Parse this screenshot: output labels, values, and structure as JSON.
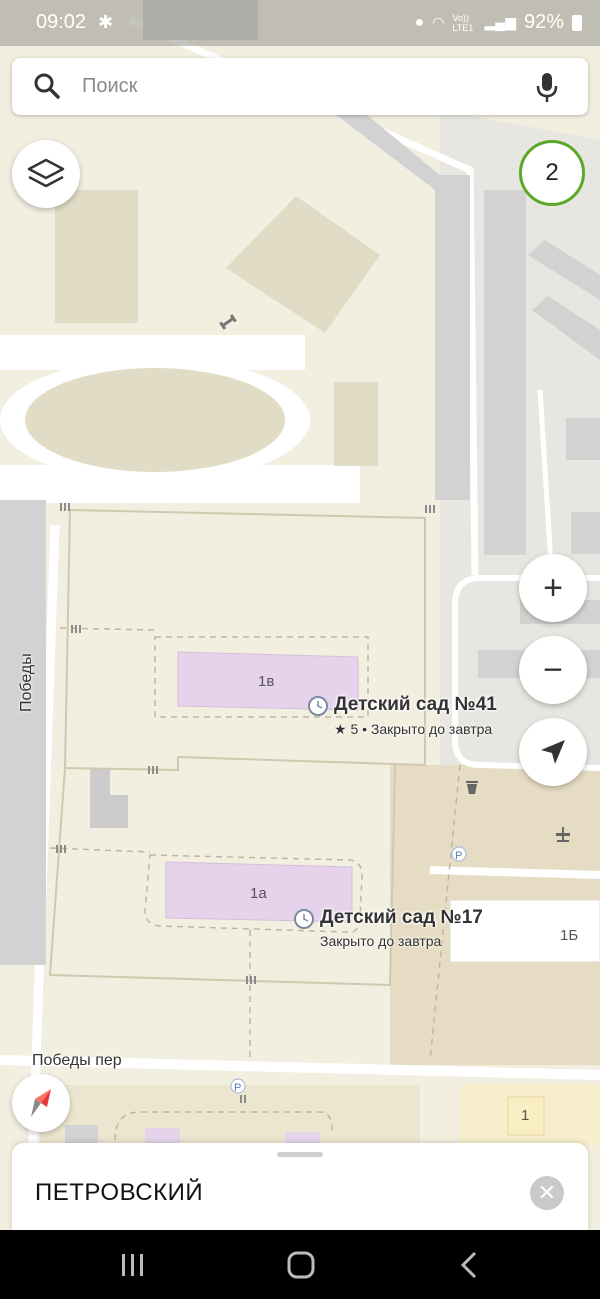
{
  "status_bar": {
    "time": "09:02",
    "network": "Vo)) LTE1",
    "battery": "92%"
  },
  "search": {
    "placeholder": "Поиск",
    "icon": "search-icon",
    "mic_icon": "microphone-icon"
  },
  "map": {
    "cluster_badge": "2",
    "buildings": [
      "1в",
      "1а",
      "1Б",
      "1"
    ],
    "streets": [
      "Победы",
      "Победы пер"
    ],
    "pois": [
      {
        "name": "Детский сад №41",
        "subtitle": "★ 5 • Закрыто до завтра"
      },
      {
        "name": "Детский сад №17",
        "subtitle": "Закрыто до завтра"
      }
    ],
    "colors": {
      "background": "#f3efe0",
      "building": "#d4d4d4",
      "school_building": "#e6d3eb",
      "road": "#ffffff",
      "accent_green": "#5aa92a"
    }
  },
  "controls": {
    "layers": "layers-icon",
    "zoom_in": "+",
    "zoom_out": "−",
    "locate": "navigation-arrow-icon",
    "compass": "compass-icon"
  },
  "sheet": {
    "title": "ПЕТРОВСКИЙ",
    "close": "✕"
  },
  "nav_bar": {
    "recent": "recent-apps-icon",
    "home": "home-icon",
    "back": "back-icon"
  }
}
